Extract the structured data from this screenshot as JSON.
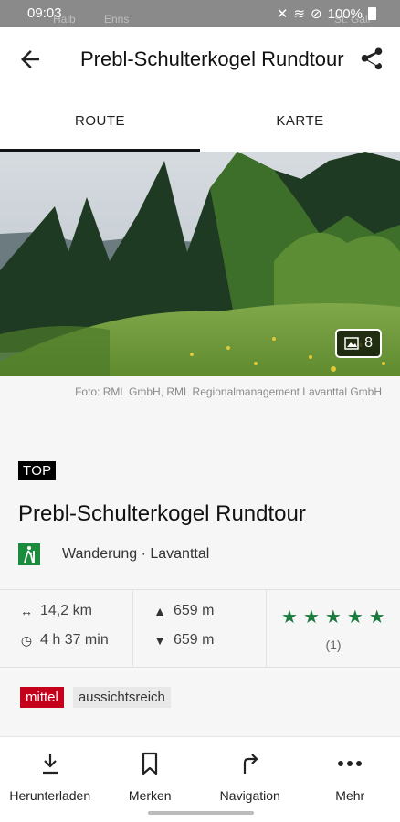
{
  "status_bar": {
    "time": "09:03",
    "battery": "100%",
    "background_labels": [
      "Halb",
      "Enns",
      "St. Gall"
    ]
  },
  "app_bar": {
    "title": "Prebl-Schulterkogel Rundtour",
    "back_icon": "arrow-left-icon",
    "share_icon": "share-icon"
  },
  "tabs": [
    {
      "label": "ROUTE",
      "active": true
    },
    {
      "label": "KARTE",
      "active": false
    }
  ],
  "hero": {
    "photo_count": "8",
    "credit": "Foto: RML GmbH, RML Regionalmanagement Lavanttal GmbH"
  },
  "tour": {
    "badge": "TOP",
    "title": "Prebl-Schulterkogel Rundtour",
    "category": "Wanderung",
    "separator": "·",
    "region": "Lavanttal"
  },
  "stats": {
    "distance": "14,2 km",
    "duration": "4 h 37 min",
    "ascent": "659 m",
    "descent": "659 m",
    "stars": 5,
    "rating_count": "(1)"
  },
  "tags": {
    "difficulty": "mittel",
    "properties": [
      "aussichtsreich"
    ]
  },
  "bottom_nav": [
    {
      "label": "Herunterladen",
      "icon": "download-icon"
    },
    {
      "label": "Merken",
      "icon": "bookmark-icon"
    },
    {
      "label": "Navigation",
      "icon": "turn-right-icon"
    },
    {
      "label": "Mehr",
      "icon": "more-icon"
    }
  ],
  "colors": {
    "accent_green": "#1a8c3c",
    "difficulty_red": "#c4001a",
    "status_bar": "#8a8a8a"
  }
}
